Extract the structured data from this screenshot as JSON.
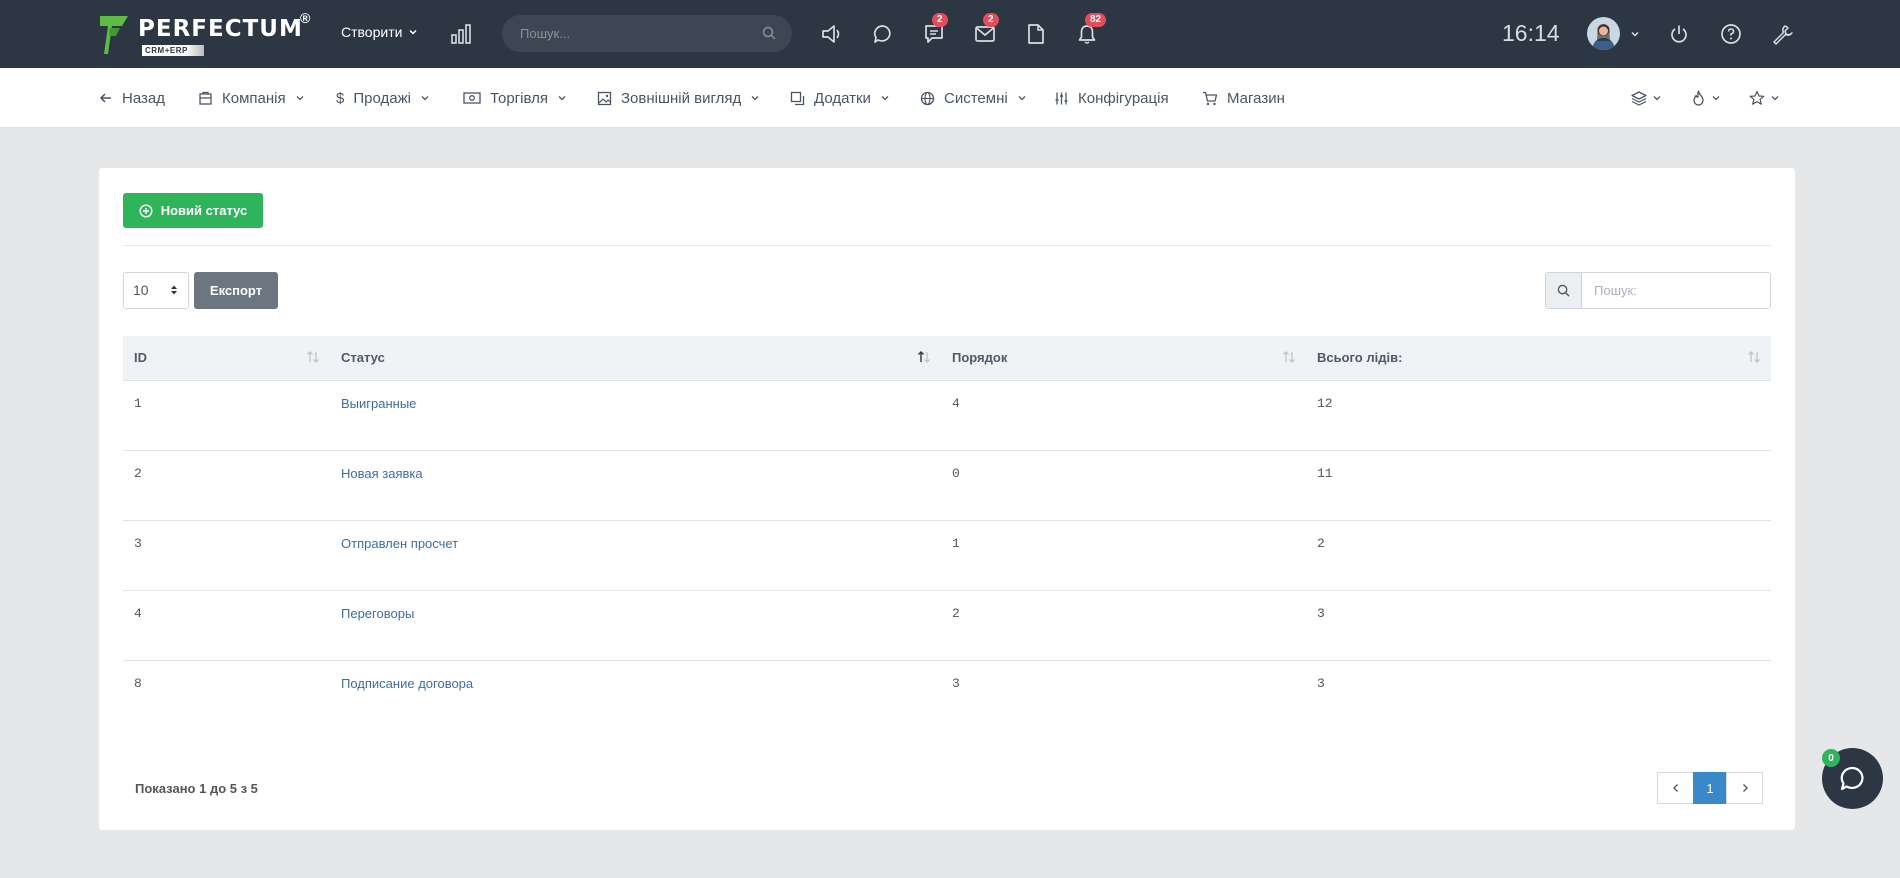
{
  "brand": {
    "name": "PERFECTUM",
    "reg": "®",
    "sub": "CRM+ERP"
  },
  "topbar": {
    "create_label": "Створити",
    "search_placeholder": "Пошук...",
    "badges": {
      "messages": "2",
      "mail": "2",
      "notifications": "82"
    },
    "time": "16:14"
  },
  "nav": {
    "back": "Назад",
    "items": [
      {
        "label": "Компанія"
      },
      {
        "label": "Продажі"
      },
      {
        "label": "Торгівля"
      },
      {
        "label": "Зовнішній вигляд"
      },
      {
        "label": "Додатки"
      },
      {
        "label": "Системні"
      },
      {
        "label": "Конфігурація"
      },
      {
        "label": "Магазин"
      }
    ]
  },
  "toolbar": {
    "new_status": "Новий статус",
    "page_length": "10",
    "export": "Експорт",
    "search_placeholder": "Пошук:"
  },
  "table": {
    "columns": [
      "ID",
      "Статус",
      "Порядок",
      "Всього лідів:"
    ],
    "rows": [
      {
        "id": "1",
        "status": "Выигранные",
        "order": "4",
        "leads": "12"
      },
      {
        "id": "2",
        "status": "Новая заявка",
        "order": "0",
        "leads": "11"
      },
      {
        "id": "3",
        "status": "Отправлен просчет",
        "order": "1",
        "leads": "2"
      },
      {
        "id": "4",
        "status": "Переговоры",
        "order": "2",
        "leads": "3"
      },
      {
        "id": "8",
        "status": "Подписание договора",
        "order": "3",
        "leads": "3"
      }
    ]
  },
  "footer": {
    "info": "Показано 1 до 5 з 5",
    "current_page": "1"
  },
  "chat": {
    "count": "0"
  },
  "colors": {
    "topbar": "#2d3643",
    "primary_green": "#2fb35b",
    "accent_blue": "#3a87c9",
    "badge_red": "#e24c5c"
  }
}
